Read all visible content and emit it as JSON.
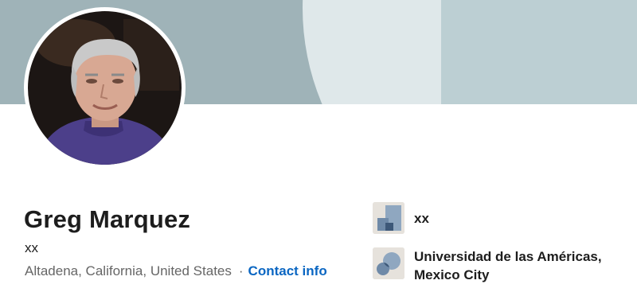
{
  "profile": {
    "name": "Greg Marquez",
    "headline": "xx",
    "location": "Altadena, California, United States",
    "separator": "·",
    "contact_info_label": "Contact info"
  },
  "right_rail": {
    "company": {
      "name": "xx",
      "icon": "company-logo-icon"
    },
    "school": {
      "name": "Universidad de las Américas, Mexico City",
      "icon": "school-logo-icon"
    }
  },
  "colors": {
    "link": "#0a66c2",
    "banner": "#9fb3b8"
  }
}
